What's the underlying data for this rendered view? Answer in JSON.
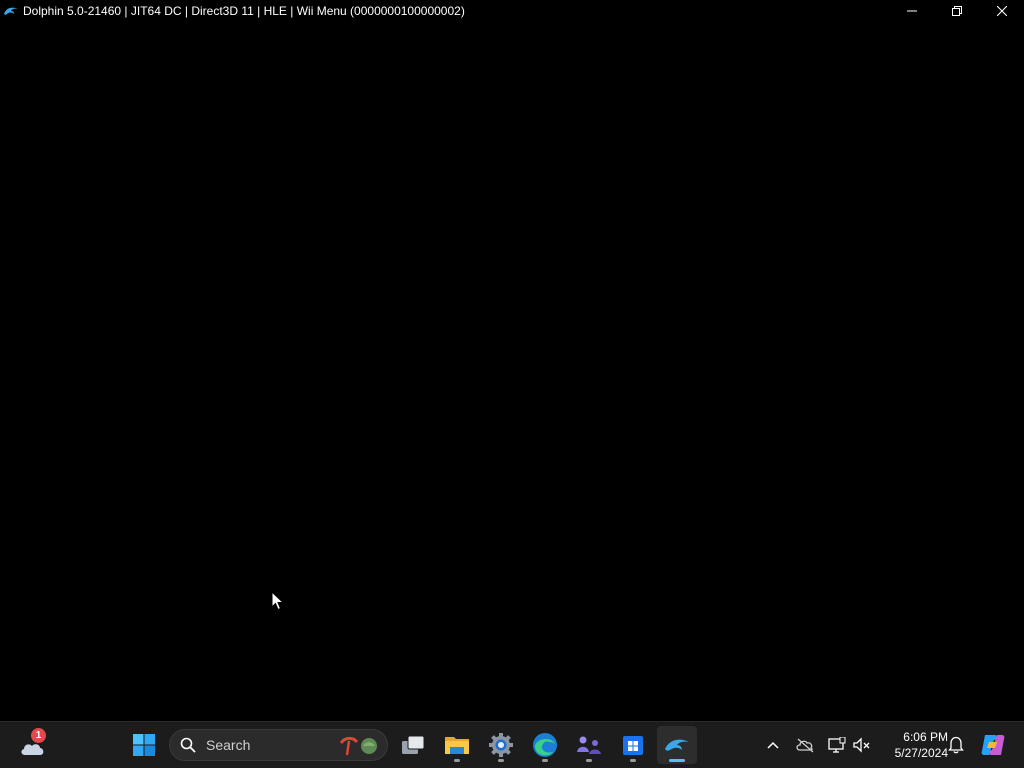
{
  "window": {
    "title": "Dolphin 5.0-21460 | JIT64 DC | Direct3D 11 | HLE | Wii Menu (0000000100000002)",
    "app_icon": "dolphin-icon",
    "controls": [
      "minimize-icon",
      "restore-icon",
      "close-icon"
    ]
  },
  "game_area": {
    "background": "#000000"
  },
  "taskbar": {
    "weather_badge": "1",
    "search": {
      "label": "Search"
    },
    "pinned": [
      {
        "name": "task-view",
        "icon": "task-view-icon",
        "running": false
      },
      {
        "name": "file-explorer",
        "icon": "folder-icon",
        "running": true
      },
      {
        "name": "settings",
        "icon": "gear-icon",
        "running": true
      },
      {
        "name": "edge",
        "icon": "edge-icon",
        "running": true
      },
      {
        "name": "teams",
        "icon": "teams-icon",
        "running": true
      },
      {
        "name": "store",
        "icon": "store-icon",
        "running": true
      },
      {
        "name": "dolphin",
        "icon": "dolphin-icon",
        "running": true,
        "active": true
      }
    ],
    "tray": {
      "icons": [
        "chevron-up-icon",
        "cloud-off-icon",
        "display-icon",
        "volume-muted-icon",
        "bell-icon",
        "copilot-icon"
      ],
      "time": "6:06 PM",
      "date": "5/27/2024"
    }
  },
  "colors": {
    "taskbar_bg": "#1c1c1c",
    "accent": "#4cc2ff",
    "badge": "#e5484d"
  }
}
